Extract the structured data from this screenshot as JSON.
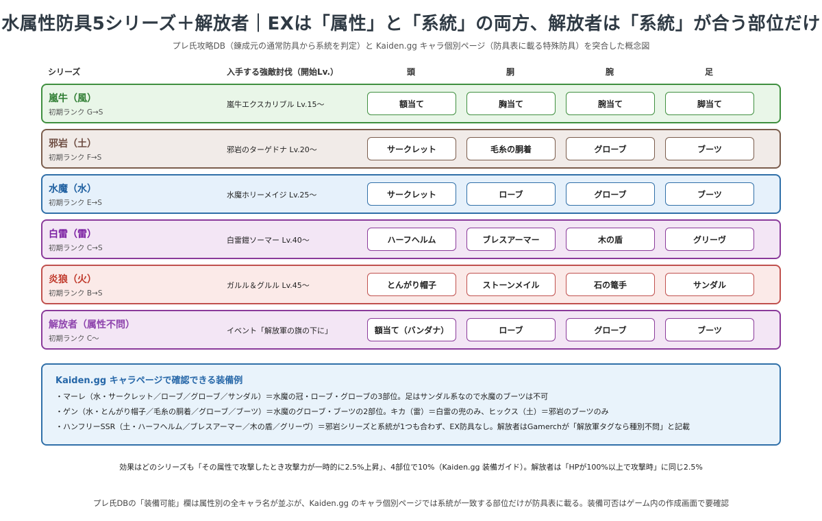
{
  "title": "水属性防具5シリーズ＋解放者｜EXは「属性」と「系統」の両方、解放者は「系統」が合う部位だけ",
  "subtitle": "プレ氏攻略DB（錬成元の通常防具から系統を判定）と Kaiden.gg キャラ個別ページ（防具表に載る特殊防具）を突合した概念図",
  "headers": {
    "series": "シリーズ",
    "quest": "入手する強敵討伐（開始Lv.）",
    "head": "頭",
    "body": "胴",
    "arm": "腕",
    "leg": "足"
  },
  "rows": [
    {
      "name": "嵐牛（風）",
      "rank": "初期ランク G→S",
      "quest": "嵐牛エクスカリブル Lv.15〜",
      "slots": [
        "額当て",
        "胸当て",
        "腕当て",
        "脚当て"
      ],
      "colors": {
        "border": "#3f8f3f",
        "bg": "#e9f6e8",
        "name": "#2e7d32"
      }
    },
    {
      "name": "邪岩（土）",
      "rank": "初期ランク F→S",
      "quest": "邪岩のターゲドナ Lv.20〜",
      "slots": [
        "サークレット",
        "毛糸の胴着",
        "グローブ",
        "ブーツ"
      ],
      "colors": {
        "border": "#7a5c4c",
        "bg": "#f1ebe8",
        "name": "#6d4c41"
      }
    },
    {
      "name": "水魔（水）",
      "rank": "初期ランク E→S",
      "quest": "水魔ホリーメイジ Lv.25〜",
      "slots": [
        "サークレット",
        "ローブ",
        "グローブ",
        "ブーツ"
      ],
      "colors": {
        "border": "#2f6fa8",
        "bg": "#e6f1fb",
        "name": "#1e5fa0"
      }
    },
    {
      "name": "白雷（雷）",
      "rank": "初期ランク C→S",
      "quest": "白雷鎧ソーマー Lv.40〜",
      "slots": [
        "ハーフヘルム",
        "ブレスアーマー",
        "木の盾",
        "グリーヴ"
      ],
      "colors": {
        "border": "#8a3a9a",
        "bg": "#f3e6f5",
        "name": "#7b1fa2"
      }
    },
    {
      "name": "炎狼（火）",
      "rank": "初期ランク B→S",
      "quest": "ガルル＆グルル Lv.45〜",
      "slots": [
        "とんがり帽子",
        "ストーンメイル",
        "石の篭手",
        "サンダル"
      ],
      "colors": {
        "border": "#c0504d",
        "bg": "#fbeae8",
        "name": "#c0392b"
      }
    },
    {
      "name": "解放者（属性不問）",
      "rank": "初期ランク C〜",
      "quest": "イベント「解放軍の旗の下に」",
      "slots": [
        "額当て（バンダナ）",
        "ローブ",
        "グローブ",
        "ブーツ"
      ],
      "colors": {
        "border": "#8a3a9a",
        "bg": "#f3e6f5",
        "name": "#8e44ad"
      }
    }
  ],
  "info": {
    "heading": "Kaiden.gg キャラページで確認できる装備例",
    "lines": [
      "・マーレ（水・サークレット／ローブ／グローブ／サンダル）＝水魔の冠・ローブ・グローブの3部位。足はサンダル系なので水魔のブーツは不可",
      "・ゲン（水・とんがり帽子／毛糸の胴着／グローブ／ブーツ）＝水魔のグローブ・ブーツの2部位。キカ（雷）＝白雷の兜のみ、ヒックス（土）＝邪岩のブーツのみ",
      "・ハンフリーSSR（土・ハーフヘルム／ブレスアーマー／木の盾／グリーヴ）＝邪岩シリーズと系統が1つも合わず、EX防具なし。解放者はGamerchが「解放軍タグなら種別不問」と記載"
    ]
  },
  "footnote1": "効果はどのシリーズも「その属性で攻撃したとき攻撃力が一時的に2.5%上昇」、4部位で10%（Kaiden.gg 装備ガイド）。解放者は「HPが100%以上で攻撃時」に同じ2.5%",
  "footnote2": "プレ氏DBの「装備可能」欄は属性別の全キャラ名が並ぶが、Kaiden.gg のキャラ個別ページでは系統が一致する部位だけが防具表に載る。装備可否はゲーム内の作成画面で要確認"
}
